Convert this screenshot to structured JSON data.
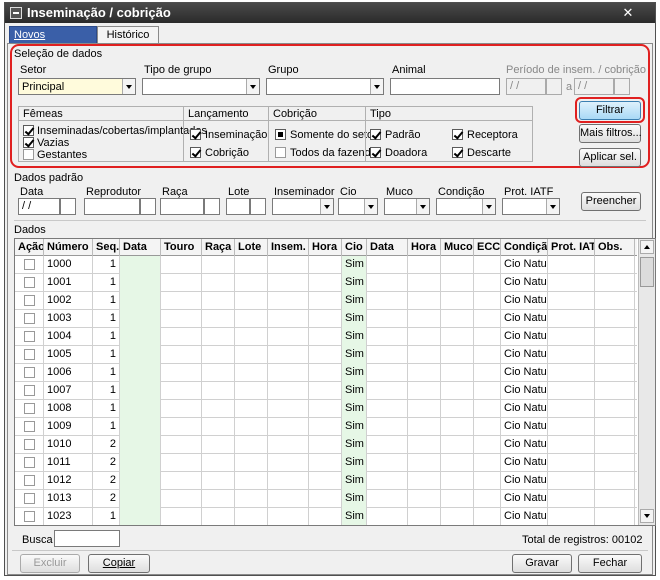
{
  "window": {
    "title": "Inseminação / cobrição",
    "close_label": "✕"
  },
  "tabs": [
    "Novos lançamentos",
    "Histórico"
  ],
  "selecao": {
    "title": "Seleção de dados",
    "setor_label": "Setor",
    "setor_value": "Principal",
    "tipo_grupo_label": "Tipo de grupo",
    "tipo_grupo_value": "",
    "grupo_label": "Grupo",
    "grupo_value": "",
    "animal_label": "Animal",
    "animal_value": "",
    "periodo_label": "Período de insem. / cobrição",
    "periodo_from": "/ /",
    "periodo_sep": "a",
    "periodo_to": "/ /",
    "femeas": {
      "title": "Fêmeas",
      "items": [
        {
          "label": "Inseminadas/cobertas/implantadas",
          "checked": true
        },
        {
          "label": "Vazias",
          "checked": true
        },
        {
          "label": "Gestantes",
          "checked": false
        }
      ]
    },
    "lancamento": {
      "title": "Lançamento",
      "items": [
        {
          "label": "Inseminação",
          "checked": true
        },
        {
          "label": "Cobrição",
          "checked": true
        }
      ]
    },
    "cobricao": {
      "title": "Cobrição",
      "items": [
        {
          "label": "Somente do setor",
          "checked": "partial"
        },
        {
          "label": "Todos da fazenda",
          "checked": false
        }
      ]
    },
    "tipo": {
      "title": "Tipo",
      "items": [
        {
          "label": "Padrão",
          "checked": true
        },
        {
          "label": "Receptora",
          "checked": true
        },
        {
          "label": "Doadora",
          "checked": true
        },
        {
          "label": "Descarte",
          "checked": true
        }
      ]
    },
    "buttons": {
      "filtrar": "Filtrar",
      "mais_filtros": "Mais filtros...",
      "aplicar_sel": "Aplicar sel."
    }
  },
  "padrao": {
    "title": "Dados padrão",
    "labels": [
      "Data",
      "Reprodutor",
      "Raça",
      "Lote",
      "Inseminador",
      "Cio",
      "Muco",
      "Condição",
      "Prot. IATF"
    ],
    "data_value": "/ /",
    "preencher": "Preencher"
  },
  "dados": {
    "title": "Dados",
    "columns": [
      "Ação",
      "Número",
      "Seq.",
      "Data",
      "Touro",
      "Raça",
      "Lote",
      "Insem.",
      "Hora",
      "Cio",
      "Data",
      "Hora",
      "Muco",
      "ECC",
      "Condição",
      "Prot. IATF",
      "Obs."
    ],
    "rows": [
      {
        "numero": "1000",
        "seq": "1",
        "cio": "Sim",
        "condicao": "Cio Natural"
      },
      {
        "numero": "1001",
        "seq": "1",
        "cio": "Sim",
        "condicao": "Cio Natural"
      },
      {
        "numero": "1002",
        "seq": "1",
        "cio": "Sim",
        "condicao": "Cio Natural"
      },
      {
        "numero": "1003",
        "seq": "1",
        "cio": "Sim",
        "condicao": "Cio Natural"
      },
      {
        "numero": "1004",
        "seq": "1",
        "cio": "Sim",
        "condicao": "Cio Natural"
      },
      {
        "numero": "1005",
        "seq": "1",
        "cio": "Sim",
        "condicao": "Cio Natural"
      },
      {
        "numero": "1006",
        "seq": "1",
        "cio": "Sim",
        "condicao": "Cio Natural"
      },
      {
        "numero": "1007",
        "seq": "1",
        "cio": "Sim",
        "condicao": "Cio Natural"
      },
      {
        "numero": "1008",
        "seq": "1",
        "cio": "Sim",
        "condicao": "Cio Natural"
      },
      {
        "numero": "1009",
        "seq": "1",
        "cio": "Sim",
        "condicao": "Cio Natural"
      },
      {
        "numero": "1010",
        "seq": "2",
        "cio": "Sim",
        "condicao": "Cio Natural"
      },
      {
        "numero": "1011",
        "seq": "2",
        "cio": "Sim",
        "condicao": "Cio Natural"
      },
      {
        "numero": "1012",
        "seq": "2",
        "cio": "Sim",
        "condicao": "Cio Natural"
      },
      {
        "numero": "1013",
        "seq": "2",
        "cio": "Sim",
        "condicao": "Cio Natural"
      },
      {
        "numero": "1023",
        "seq": "1",
        "cio": "Sim",
        "condicao": "Cio Natural"
      }
    ]
  },
  "footer": {
    "busca_label": "Busca",
    "busca_value": "",
    "total_label": "Total de registros: 00102",
    "excluir": "Excluir",
    "copiar": "Copiar",
    "gravar": "Gravar",
    "fechar": "Fechar"
  },
  "colors": {
    "highlight": "#e02020",
    "filtrar_bg": "#a9d9f6",
    "tab_active": "#3a5fa8",
    "green_col": "#e6f7e6",
    "title_bar": "#2a2a2a"
  },
  "icons": [
    "window-menu-icon",
    "close-icon",
    "dropdown-arrow-icon",
    "checkmark-icon",
    "scroll-up-icon",
    "scroll-down-icon"
  ]
}
